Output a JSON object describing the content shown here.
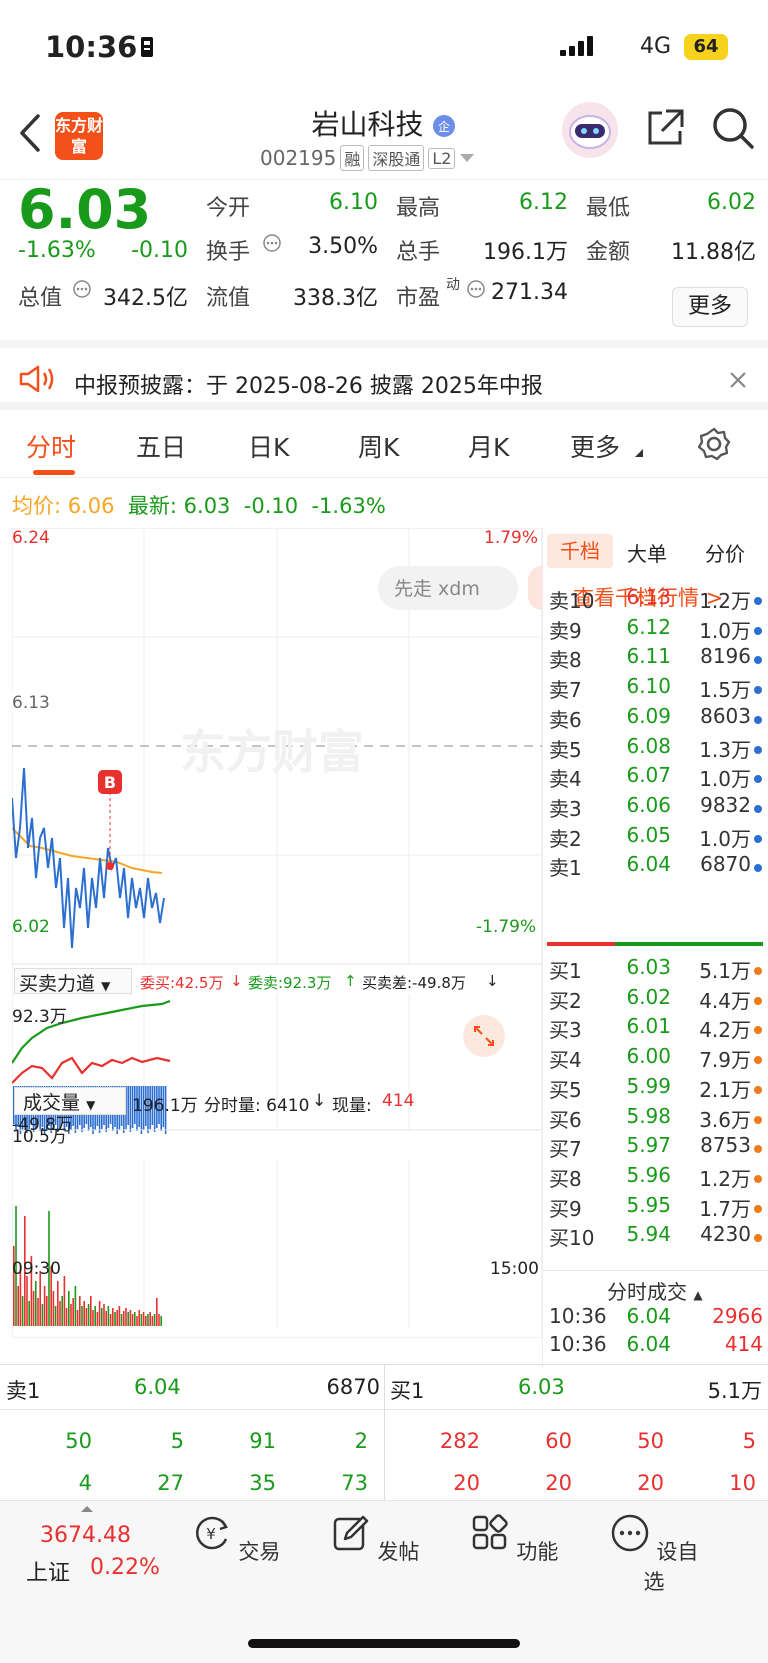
{
  "status_bar": {
    "time": "10:36",
    "network": "4G",
    "battery": "64"
  },
  "header": {
    "back": "<",
    "logo_text": "东方财富",
    "stock_name": "岩山科技",
    "stock_code": "002195",
    "tags": [
      "融",
      "深股通",
      "L2"
    ]
  },
  "quote": {
    "price": "6.03",
    "change_pct": "-1.63%",
    "change": "-0.10",
    "open_label": "今开",
    "open": "6.10",
    "high_label": "最高",
    "high": "6.12",
    "low_label": "最低",
    "low": "6.02",
    "turnover_label": "换手",
    "turnover": "3.50%",
    "volume_label": "总手",
    "volume": "196.1万",
    "amount_label": "金额",
    "amount": "11.88亿",
    "mktcap_label": "总值",
    "mktcap": "342.5亿",
    "float_label": "流值",
    "float": "338.3亿",
    "pe_label": "市盈",
    "pe_sup": "动",
    "pe": "271.34",
    "more": "更多"
  },
  "notice": {
    "text": "中报预披露：于 2025-08-26 披露 2025年中报"
  },
  "tabs": [
    "分时",
    "五日",
    "日K",
    "周K",
    "月K",
    "更多"
  ],
  "infoline": {
    "avg_label": "均价:",
    "avg": "6.06",
    "latest_label": "最新:",
    "latest": "6.03",
    "chg": "-0.10",
    "pct": "-1.63%"
  },
  "chart": {
    "price_max": "6.24",
    "price_min": "6.02",
    "pct_max": "1.79%",
    "pct_min": "-1.79%",
    "prev_close": "6.13",
    "watermark": "东方财富",
    "b_marker": "B",
    "ad_pill": "先走 xdm",
    "flow_label": "买卖力道",
    "flow_buy": "委买:42.5万",
    "flow_sell": "委卖:92.3万",
    "flow_diff": "买卖差:-49.8万",
    "flow_top": "92.3万",
    "flow_bottom": "-49.8万",
    "vol_label": "成交量",
    "vol_total": "196.1万",
    "vol_min_label": "分时量: 6410",
    "vol_now_label": "现量:",
    "vol_now": "414",
    "vol_max": "10.5万",
    "time_start": "09:30",
    "time_end": "15:00"
  },
  "book": {
    "tabs": [
      "千档",
      "大单",
      "分价"
    ],
    "link": "查看千档行情 >",
    "sells": [
      {
        "label": "卖10",
        "price": "6.13",
        "vol": "1.2万",
        "c": "red"
      },
      {
        "label": "卖9",
        "price": "6.12",
        "vol": "1.0万",
        "c": "green"
      },
      {
        "label": "卖8",
        "price": "6.11",
        "vol": "8196",
        "c": "green"
      },
      {
        "label": "卖7",
        "price": "6.10",
        "vol": "1.5万",
        "c": "green"
      },
      {
        "label": "卖6",
        "price": "6.09",
        "vol": "8603",
        "c": "green"
      },
      {
        "label": "卖5",
        "price": "6.08",
        "vol": "1.3万",
        "c": "green"
      },
      {
        "label": "卖4",
        "price": "6.07",
        "vol": "1.0万",
        "c": "green"
      },
      {
        "label": "卖3",
        "price": "6.06",
        "vol": "9832",
        "c": "green"
      },
      {
        "label": "卖2",
        "price": "6.05",
        "vol": "1.0万",
        "c": "green"
      },
      {
        "label": "卖1",
        "price": "6.04",
        "vol": "6870",
        "c": "green"
      }
    ],
    "buys": [
      {
        "label": "买1",
        "price": "6.03",
        "vol": "5.1万"
      },
      {
        "label": "买2",
        "price": "6.02",
        "vol": "4.4万"
      },
      {
        "label": "买3",
        "price": "6.01",
        "vol": "4.2万"
      },
      {
        "label": "买4",
        "price": "6.00",
        "vol": "7.9万"
      },
      {
        "label": "买5",
        "price": "5.99",
        "vol": "2.1万"
      },
      {
        "label": "买6",
        "price": "5.98",
        "vol": "3.6万"
      },
      {
        "label": "买7",
        "price": "5.97",
        "vol": "8753"
      },
      {
        "label": "买8",
        "price": "5.96",
        "vol": "1.2万"
      },
      {
        "label": "买9",
        "price": "5.95",
        "vol": "1.7万"
      },
      {
        "label": "买10",
        "price": "5.94",
        "vol": "4230"
      }
    ],
    "trades_title": "分时成交",
    "trades": [
      {
        "time": "10:36",
        "price": "6.04",
        "vol": "2966"
      },
      {
        "time": "10:36",
        "price": "6.04",
        "vol": "414"
      }
    ]
  },
  "level2": {
    "sell_label": "卖1",
    "sell_price": "6.04",
    "sell_vol": "6870",
    "buy_label": "买1",
    "buy_price": "6.03",
    "buy_vol": "5.1万",
    "sell_q1": [
      "50",
      "5",
      "91",
      "2"
    ],
    "sell_q2": [
      "4",
      "27",
      "35",
      "73"
    ],
    "buy_q1": [
      "282",
      "60",
      "50",
      "5"
    ],
    "buy_q2": [
      "20",
      "20",
      "20",
      "10"
    ]
  },
  "nav": {
    "index_value": "3674.48",
    "index_name": "上证",
    "index_pct": "0.22%",
    "items": [
      "交易",
      "发帖",
      "功能",
      "设自选"
    ]
  },
  "colors": {
    "brand": "#f3501a",
    "up": "#e8302e",
    "down": "#1a9a1a",
    "line": "#2d6fd1",
    "avg": "#f5a623"
  }
}
